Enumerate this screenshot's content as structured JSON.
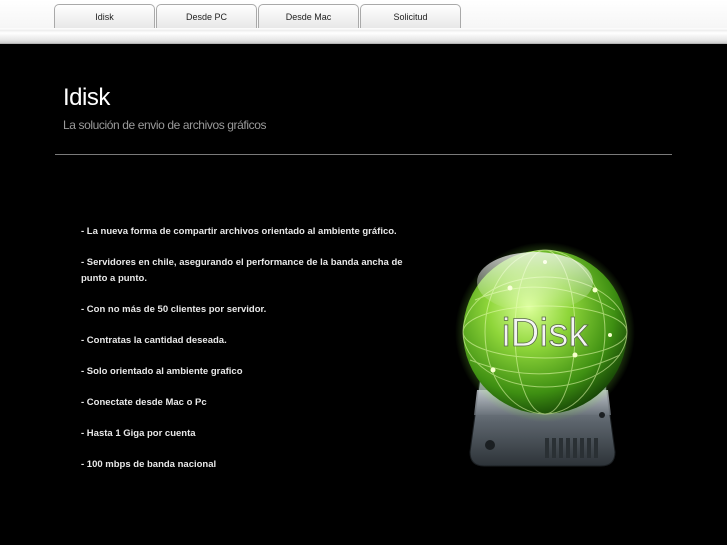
{
  "nav": {
    "tabs": [
      {
        "label": "Idisk"
      },
      {
        "label": "Desde PC"
      },
      {
        "label": "Desde Mac"
      },
      {
        "label": "Solicitud"
      }
    ]
  },
  "header": {
    "title": "Idisk",
    "subtitle": "La solución de envio de archivos gráficos"
  },
  "features": [
    "- La nueva forma de compartir archivos orientado al ambiente gráfico.",
    "- Servidores en chile, asegurando el performance de la banda ancha de punto a punto.",
    "- Con no más de 50 clientes por servidor.",
    "- Contratas la cantidad deseada.",
    "- Solo orientado al ambiente grafico",
    "- Conectate desde Mac o Pc",
    "- Hasta 1 Giga por cuenta",
    "- 100 mbps de banda nacional"
  ],
  "logo": {
    "text": "iDisk",
    "icon": "idisk-globe-drive-icon"
  }
}
